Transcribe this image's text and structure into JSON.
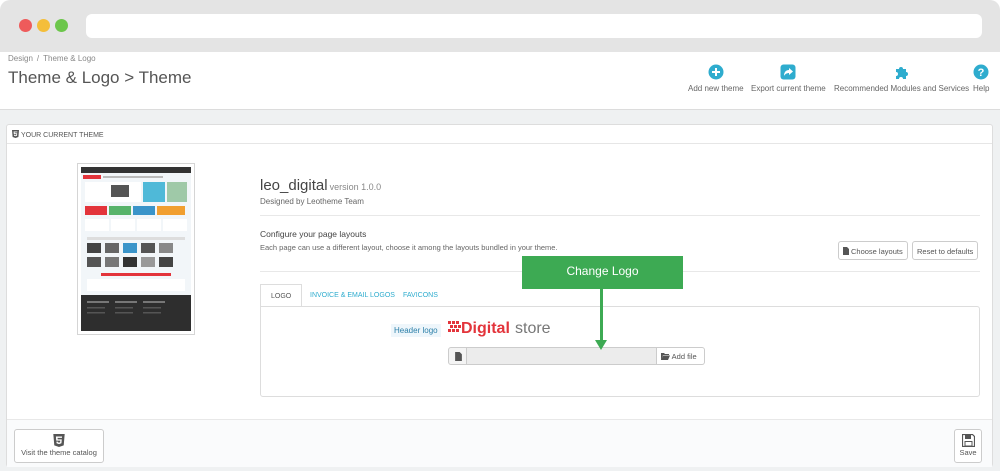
{
  "breadcrumb": {
    "root": "Design",
    "current": "Theme & Logo"
  },
  "page_title": "Theme & Logo > Theme",
  "toolbar": {
    "add_new_theme": "Add new theme",
    "export_current_theme": "Export current theme",
    "recommended": "Recommended Modules and Services",
    "help": "Help"
  },
  "panel": {
    "heading": "YOUR CURRENT THEME",
    "theme_name": "leo_digital",
    "theme_version": "version 1.0.0",
    "designed_by": "Designed by Leotheme Team",
    "configure_title": "Configure your page layouts",
    "configure_desc": "Each page can use a different layout, choose it among the layouts bundled in your theme.",
    "choose_layouts": "Choose layouts",
    "reset_defaults": "Reset to defaults"
  },
  "tabs": [
    {
      "label": "LOGO",
      "active": true
    },
    {
      "label": "INVOICE & EMAIL LOGOS",
      "active": false
    },
    {
      "label": "FAVICONS",
      "active": false
    }
  ],
  "logo_tab": {
    "header_logo_label": "Header logo",
    "logo_word_bold": "Digital",
    "logo_word_light": "store",
    "add_file": "Add file"
  },
  "footer": {
    "visit_catalog": "Visit the theme catalog",
    "save": "Save"
  },
  "annotation": {
    "label": "Change Logo"
  },
  "colors": {
    "accent": "#2eacce",
    "annotation": "#3daa53",
    "logo_red": "#e3343b"
  },
  "icons": {
    "add_new_theme": "plus-circle-icon",
    "export": "share-icon",
    "recommended": "puzzle-icon",
    "help": "question-circle-icon",
    "file": "file-icon",
    "folder": "folder-open-icon",
    "html5": "html5-icon",
    "save": "floppy-disk-icon"
  }
}
